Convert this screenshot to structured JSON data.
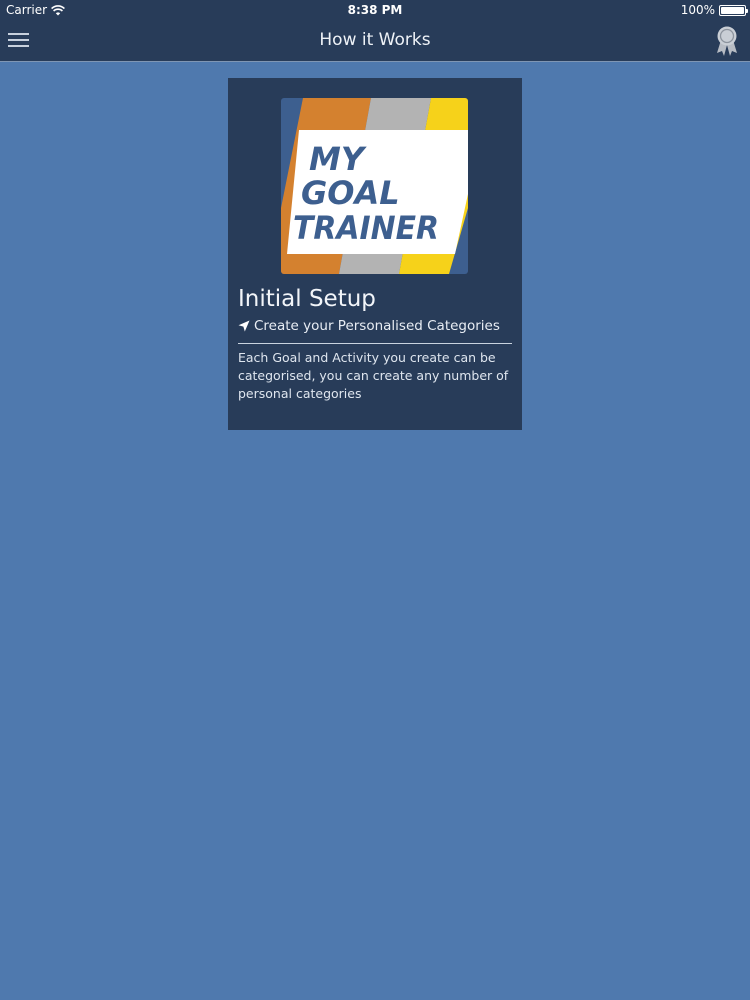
{
  "status_bar": {
    "carrier": "Carrier",
    "time": "8:38 PM",
    "battery": "100%",
    "wifi_icon": "wifi-icon",
    "battery_icon": "battery-icon"
  },
  "nav": {
    "title": "How it Works",
    "menu_icon": "hamburger-menu-icon",
    "award_icon": "award-ribbon-icon"
  },
  "card": {
    "logo": {
      "line1": "MY",
      "line2": "GOAL",
      "line3": "TRAINER",
      "colors": [
        "#d4812f",
        "#b3b3b3",
        "#f6d21a",
        "#3d5f8f"
      ]
    },
    "title": "Initial Setup",
    "subtitle": "Create your Personalised Categories",
    "subtitle_icon": "location-arrow-icon",
    "description": "Each Goal and Activity you create can be categorised, you can create any number of personal categories"
  },
  "colors": {
    "background": "#4f79ae",
    "bar": "#283c59",
    "card": "#283c59"
  }
}
